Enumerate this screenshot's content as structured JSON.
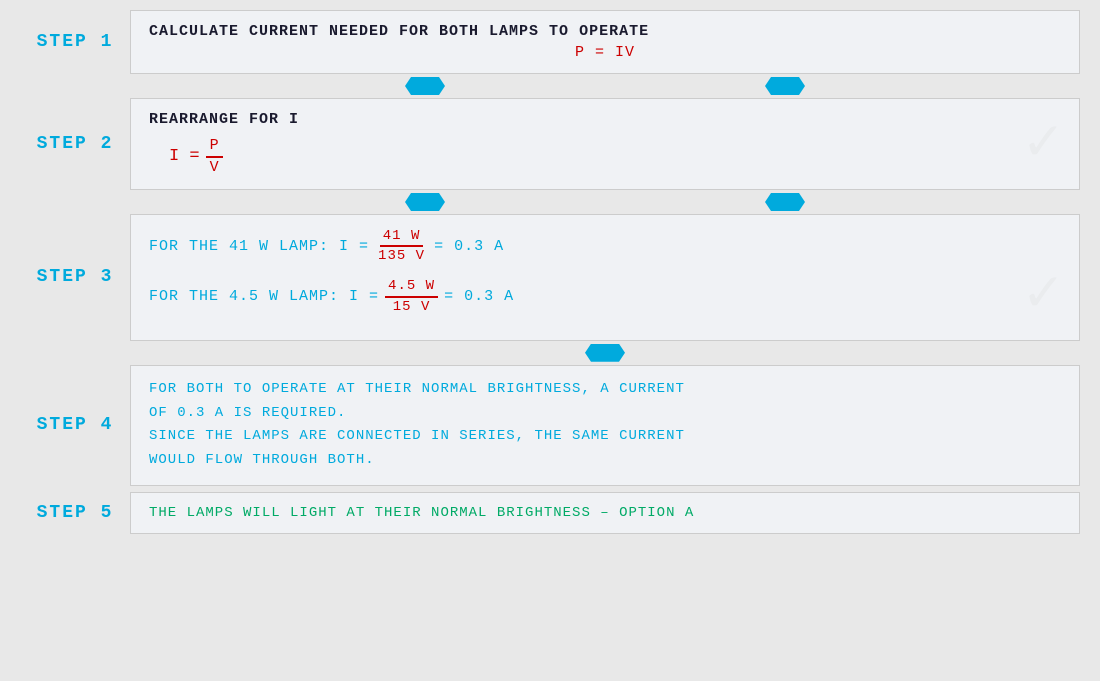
{
  "steps": [
    {
      "id": "step1",
      "label": "STEP  1",
      "title": "CALCULATE  CURRENT  NEEDED  FOR  BOTH  LAMPS  TO  OPERATE",
      "formula_display": "P = IV",
      "type": "title_formula"
    },
    {
      "id": "step2",
      "label": "STEP  2",
      "title": "REARRANGE  FOR  I",
      "type": "rearrange"
    },
    {
      "id": "step3",
      "label": "STEP  3",
      "type": "calculations",
      "line1": {
        "prefix": "FOR  THE  41 W  LAMP:  I =",
        "numer": "41 W",
        "denom": "135 V",
        "suffix": "= 0.3 A"
      },
      "line2": {
        "prefix": "FOR  THE  4.5 W  LAMP:  I =",
        "numer": "4.5 W",
        "denom": "15 V",
        "suffix": "= 0.3 A"
      }
    },
    {
      "id": "step4",
      "label": "STEP  4",
      "type": "text",
      "lines": [
        "FOR  BOTH  TO  OPERATE  AT  THEIR  NORMAL  BRIGHTNESS,  A  CURRENT",
        "OF  0.3 A  IS  REQUIRED.",
        "SINCE  THE  LAMPS  ARE  CONNECTED  IN  SERIES,  THE  SAME  CURRENT",
        "WOULD  FLOW  THROUGH  BOTH."
      ]
    },
    {
      "id": "step5",
      "label": "STEP  5",
      "type": "conclusion",
      "text": "THE  LAMPS  WILL  LIGHT  AT  THEIR  NORMAL  BRIGHTNESS – OPTION A"
    }
  ]
}
